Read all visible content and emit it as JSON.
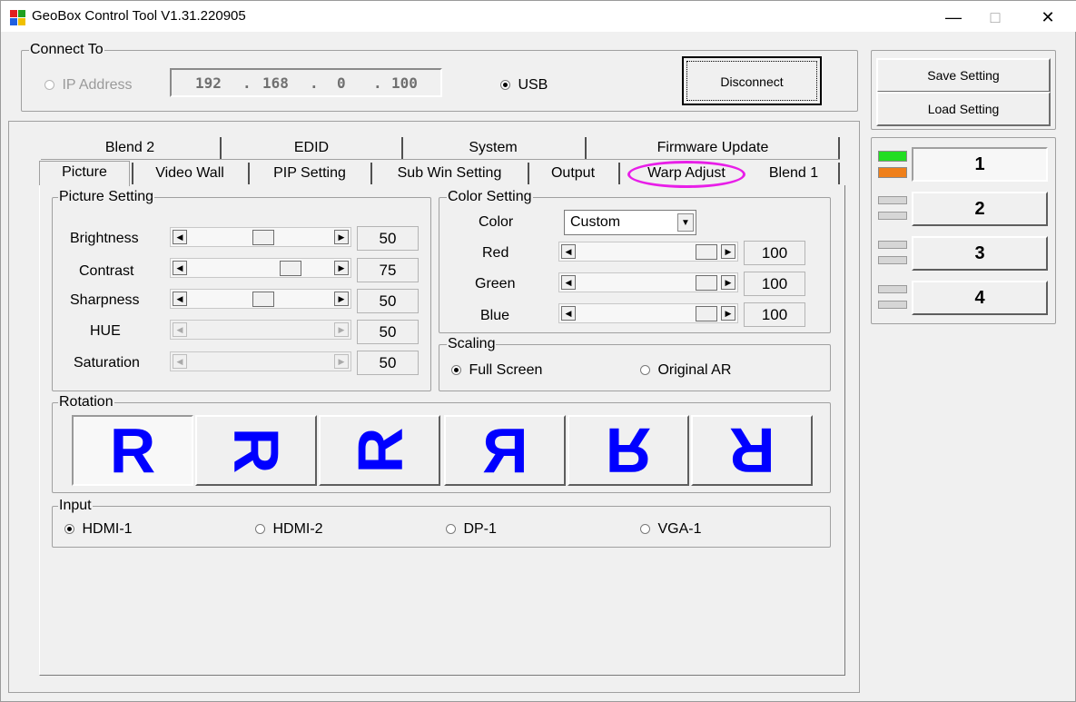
{
  "window": {
    "title": "GeoBox Control Tool  V1.31.220905",
    "minimize": "—",
    "maximize": "□",
    "close": "✕"
  },
  "connect": {
    "group_title": "Connect To",
    "ip_label": "IP Address",
    "ip": [
      "192",
      "168",
      "0",
      "100"
    ],
    "ip_dot": ".",
    "usb_label": "USB",
    "selected": "USB",
    "disconnect_label": "Disconnect"
  },
  "settings": {
    "save_label": "Save Setting",
    "load_label": "Load Setting"
  },
  "tabs": {
    "row_back": [
      "Blend 2",
      "EDID",
      "System",
      "Firmware Update"
    ],
    "row_front": [
      "Picture",
      "Video Wall",
      "PIP Setting",
      "Sub Win Setting",
      "Output",
      "Warp Adjust",
      "Blend 1"
    ],
    "active": "Picture",
    "highlighted": "Warp Adjust",
    "highlight_color": "#e81ee8"
  },
  "picture_setting": {
    "group_title": "Picture Setting",
    "items": [
      {
        "label": "Brightness",
        "value": "50",
        "level": 50,
        "enabled": true
      },
      {
        "label": "Contrast",
        "value": "75",
        "level": 75,
        "enabled": true
      },
      {
        "label": "Sharpness",
        "value": "50",
        "level": 50,
        "enabled": true
      },
      {
        "label": "HUE",
        "value": "50",
        "level": 50,
        "enabled": false
      },
      {
        "label": "Saturation",
        "value": "50",
        "level": 50,
        "enabled": false
      }
    ]
  },
  "color_setting": {
    "group_title": "Color Setting",
    "color_label": "Color",
    "color_value": "Custom",
    "items": [
      {
        "label": "Red",
        "value": "100",
        "level": 100
      },
      {
        "label": "Green",
        "value": "100",
        "level": 100
      },
      {
        "label": "Blue",
        "value": "100",
        "level": 100
      }
    ]
  },
  "scaling": {
    "group_title": "Scaling",
    "options": [
      "Full Screen",
      "Original AR"
    ],
    "selected": "Full Screen"
  },
  "rotation": {
    "group_title": "Rotation",
    "glyph": "R",
    "options": [
      "rotate-0",
      "rotate-90",
      "rotate-270",
      "flip-horizontal",
      "flip-vertical",
      "rotate-180"
    ],
    "selected": "rotate-0",
    "glyph_color": "#0000ff"
  },
  "input": {
    "group_title": "Input",
    "options": [
      "HDMI-1",
      "HDMI-2",
      "DP-1",
      "VGA-1"
    ],
    "selected": "HDMI-1"
  },
  "outputs": {
    "labels": [
      "1",
      "2",
      "3",
      "4"
    ],
    "active": "1",
    "indicator_colors": {
      "top": "#22dd22",
      "bottom": "#ef7f1a",
      "inactive": "#d6d6d6"
    }
  }
}
